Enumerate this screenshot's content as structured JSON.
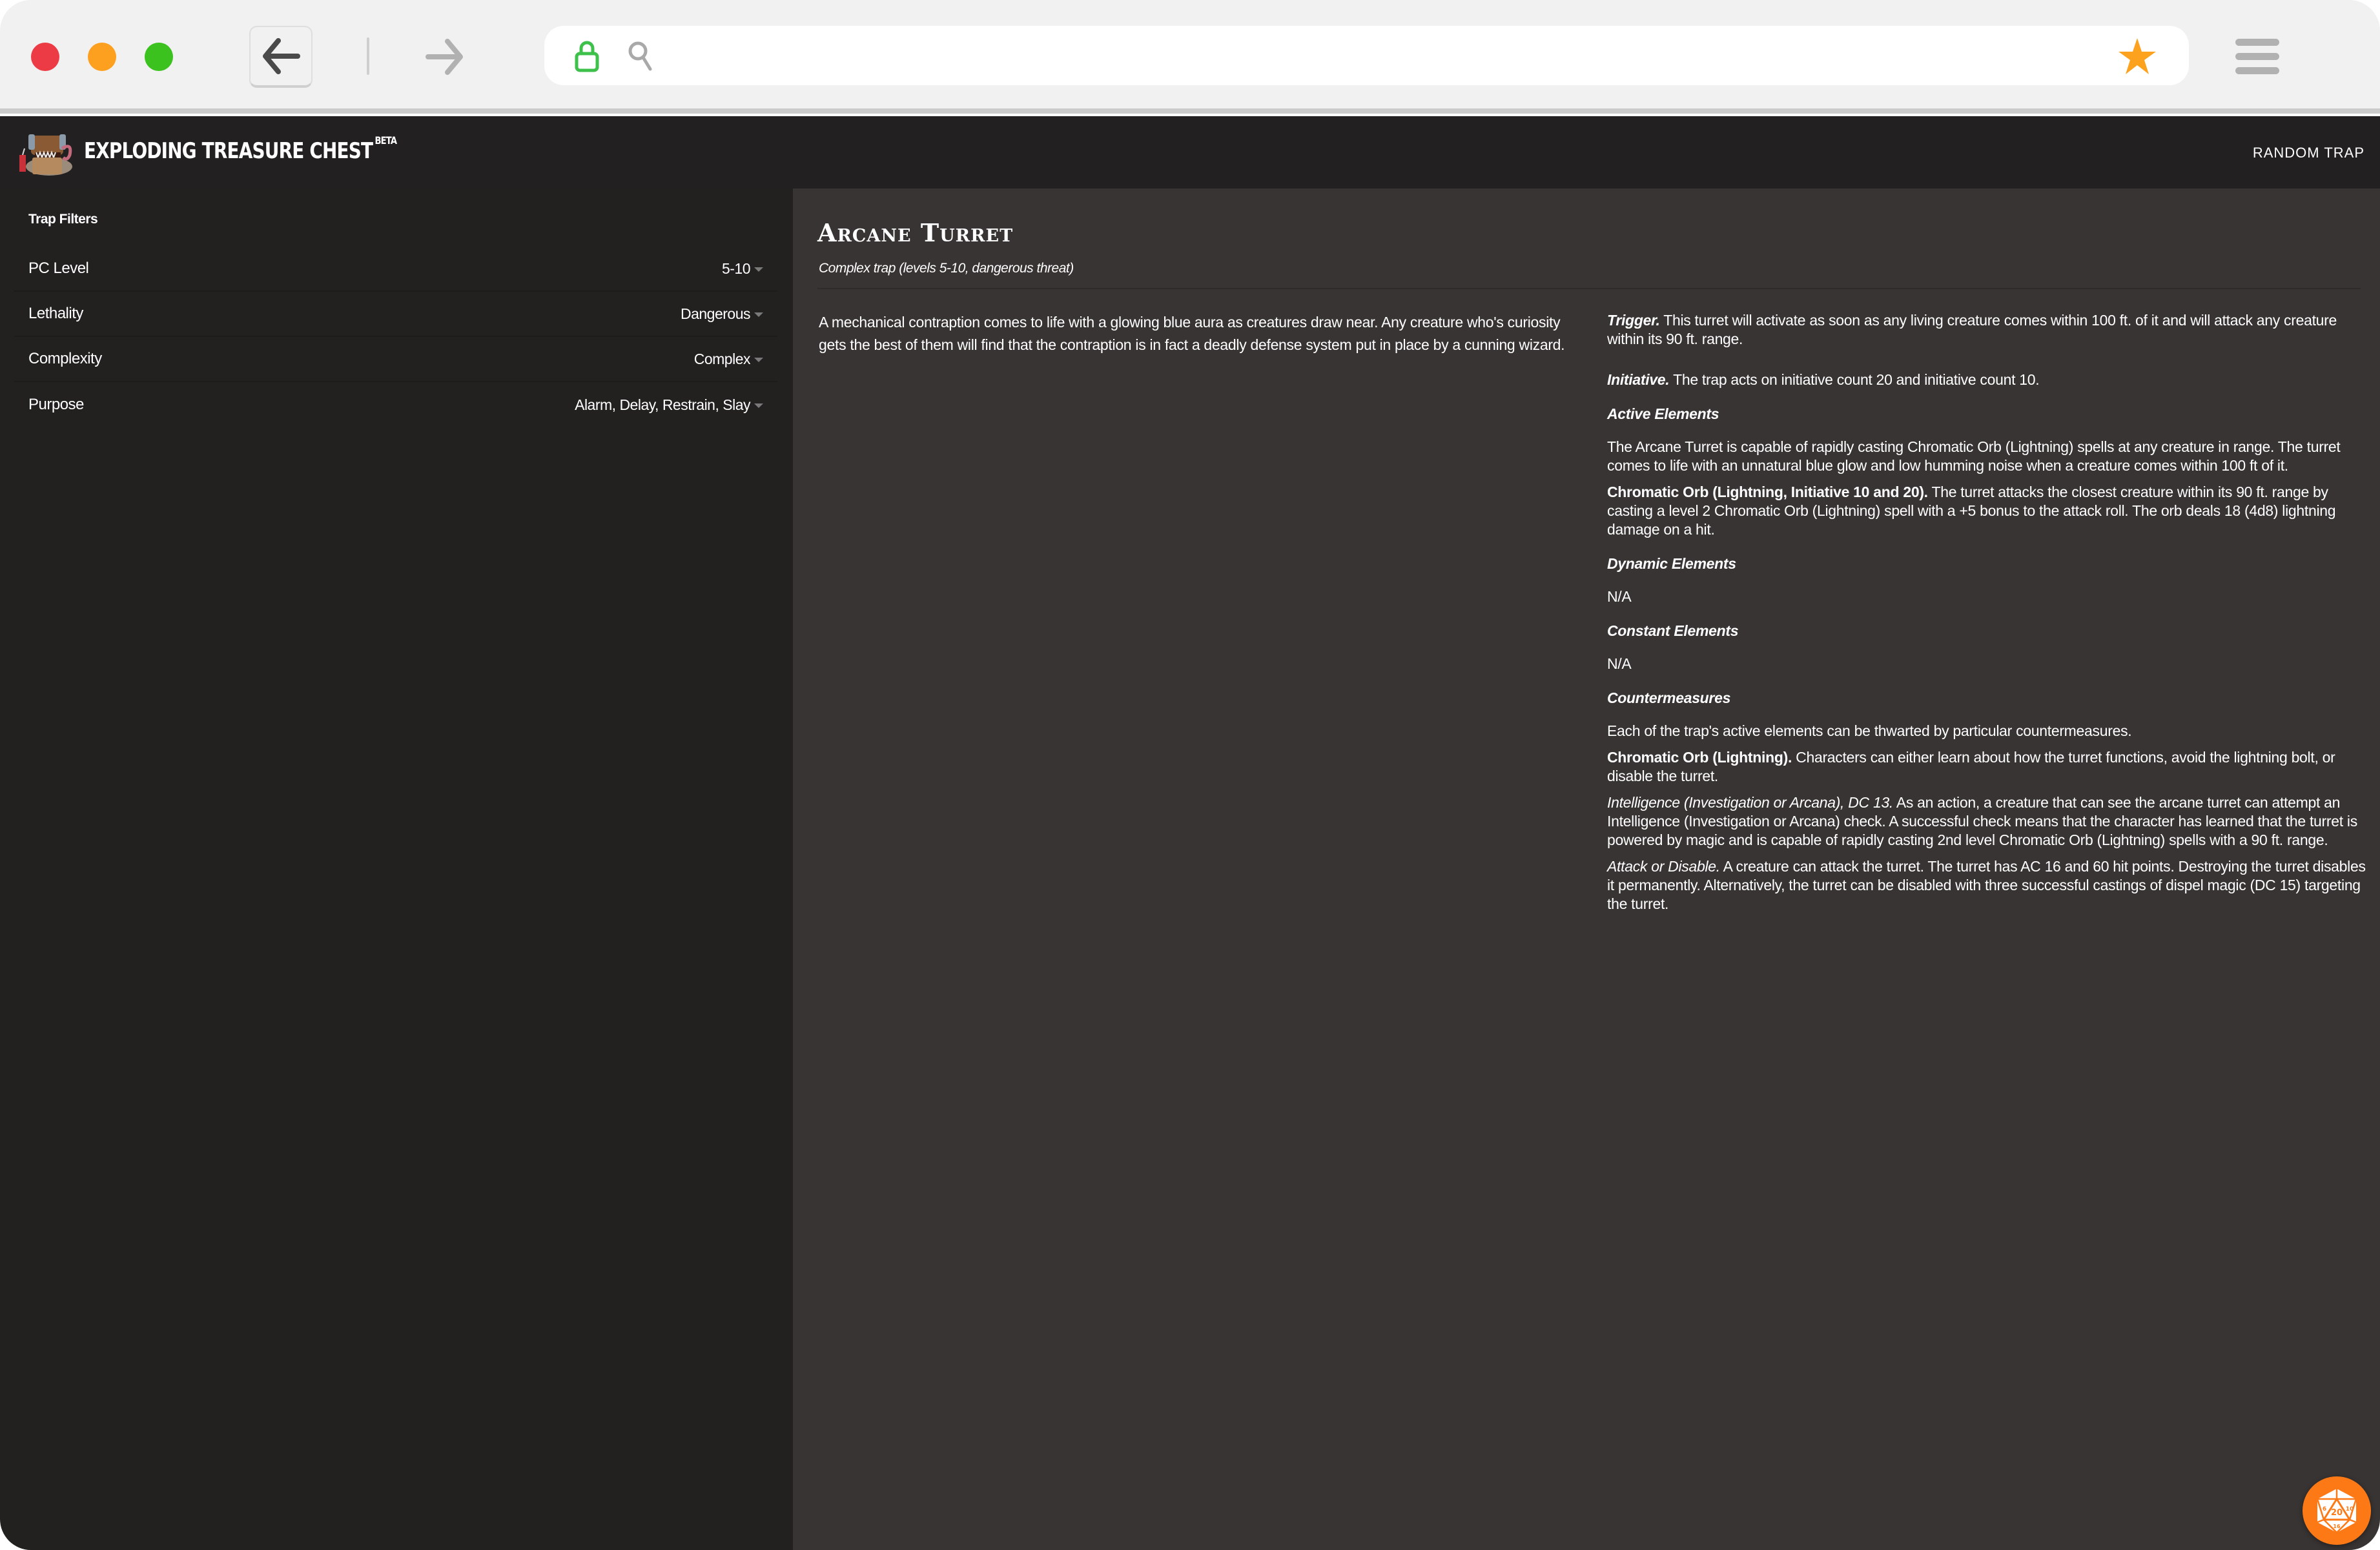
{
  "browser": {
    "url_value": "",
    "icons": {
      "back": "arrow-left-icon",
      "forward": "arrow-right-icon",
      "lock": "lock-icon",
      "search": "search-icon",
      "bookmark": "star-icon",
      "menu": "hamburger-menu-icon"
    },
    "colors": {
      "close": "#ec3b44",
      "minimize": "#fda020",
      "maximize": "#3cc21f",
      "lock": "#3dc14b",
      "star": "#fca21f"
    }
  },
  "header": {
    "brand": "EXPLODING TREASURE CHEST",
    "badge": "BETA",
    "random_trap": "RANDOM TRAP"
  },
  "sidebar": {
    "title": "Trap Filters",
    "filters": [
      {
        "label": "PC Level",
        "value": "5-10"
      },
      {
        "label": "Lethality",
        "value": "Dangerous"
      },
      {
        "label": "Complexity",
        "value": "Complex"
      },
      {
        "label": "Purpose",
        "value": "Alarm, Delay, Restrain, Slay"
      }
    ]
  },
  "trap": {
    "title": "Arcane Turret",
    "subtitle": "Complex trap (levels 5-10, dangerous threat)",
    "description": "A mechanical contraption comes to life with a glowing blue aura as creatures draw near. Any creature who's curiosity gets the best of them will find that the contraption is in fact a deadly defense system put in place by a cunning wizard.",
    "trigger": {
      "label": "Trigger.",
      "text": " This turret will activate as soon as any living creature comes within 100 ft. of it and will attack any creature within its 90 ft. range."
    },
    "initiative": {
      "label": "Initiative.",
      "text": " The trap acts on initiative count 20 and initiative count 10."
    },
    "active_elements": {
      "heading": "Active Elements",
      "intro": "The Arcane Turret is capable of rapidly casting Chromatic Orb (Lightning) spells at any creature in range. The turret comes to life with an unnatural blue glow and low humming noise when a creature comes within 100 ft of it.",
      "orb_label": "Chromatic Orb (Lightning, Initiative 10 and 20).",
      "orb_text": " The turret attacks the closest creature within its 90 ft. range by casting a level 2 Chromatic Orb (Lightning) spell with a +5 bonus to the attack roll. The orb deals 18 (4d8) lightning damage on a hit."
    },
    "dynamic_elements": {
      "heading": "Dynamic Elements",
      "text": "N/A"
    },
    "constant_elements": {
      "heading": "Constant Elements",
      "text": "N/A"
    },
    "countermeasures": {
      "heading": "Countermeasures",
      "intro": "Each of the trap's active elements can be thwarted by particular countermeasures.",
      "orb_label": "Chromatic Orb (Lightning).",
      "orb_text": " Characters can either learn about how the turret functions, avoid the lightning bolt, or disable the turret.",
      "check_label": "Intelligence (Investigation or Arcana), DC 13.",
      "check_text": " As an action, a creature that can see the arcane turret can attempt an Intelligence (Investigation or Arcana) check. A successful check means that the character has learned that the turret is powered by magic and is capable of rapidly casting 2nd level Chromatic Orb (Lightning) spells with a 90 ft. range.",
      "attack_label": "Attack or Disable.",
      "attack_text": " A creature can attack the turret. The turret has AC 16 and 60 hit points. Destroying the turret disables it permanently. Alternatively, the turret can be disabled with three successful castings of dispel magic (DC 15) targeting the turret."
    }
  },
  "dice_button": {
    "icon": "d20-icon",
    "face_numbers": [
      "20",
      "6",
      "10",
      "16"
    ],
    "color": "#fd7916"
  }
}
